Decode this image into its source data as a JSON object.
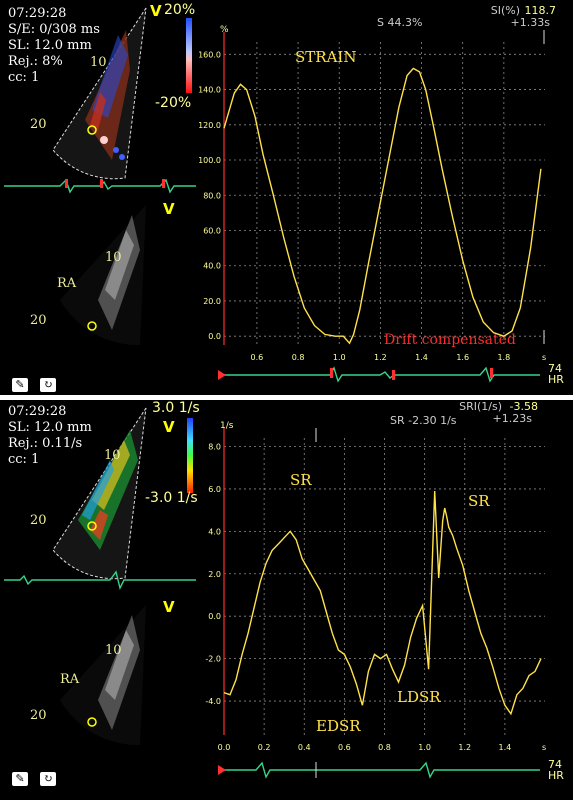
{
  "top": {
    "time": "07:29:28",
    "lines": [
      "S/E: 0/308 ms",
      "SL: 12.0 mm",
      "Rej.: 8%",
      "cc: 1"
    ],
    "scale_top": "20%",
    "scale_bottom": "-20%",
    "v_label": "V",
    "depth_labels": [
      "10",
      "20",
      "10",
      "20"
    ],
    "ra_label": "RA",
    "hr_value": "74",
    "hr_label": "HR"
  },
  "bottom": {
    "time": "07:29:28",
    "lines": [
      "SL: 12.0 mm",
      "Rej.: 0.11/s",
      "cc: 1"
    ],
    "scale_top": "3.0 1/s",
    "scale_bottom": "-3.0 1/s",
    "v_label": "V",
    "depth_labels": [
      "10",
      "20",
      "10",
      "20"
    ],
    "ra_label": "RA",
    "hr_value": "74",
    "hr_label": "HR"
  },
  "colors": {
    "trace": "#ffe24a",
    "axis_text": "#ffff99",
    "grid": "#8a8a8a",
    "ecg": "#35d48a",
    "marker": "#ff3030"
  },
  "chart_data": [
    {
      "type": "line",
      "title": "",
      "ylabel": "%",
      "xlabel": "s",
      "yticks": [
        "0.0",
        "20.0",
        "40.0",
        "60.0",
        "80.0",
        "100.0",
        "120.0",
        "140.0",
        "160.0"
      ],
      "xticks": [
        "0.6",
        "0.8",
        "1.0",
        "1.2",
        "1.4",
        "1.6",
        "1.8",
        "s"
      ],
      "xlim": [
        0.44,
        2.0
      ],
      "ylim": [
        -5,
        167
      ],
      "annotations": {
        "label": "STRAIN",
        "drift": "Drift compensated"
      },
      "readout": {
        "left": "S 44.3%",
        "right_label": "SI(%)",
        "right_value": "118.7",
        "time": "+1.33s"
      },
      "series": [
        {
          "x": [
            0.44,
            0.46,
            0.49,
            0.52,
            0.55,
            0.59,
            0.63,
            0.68,
            0.73,
            0.78,
            0.83,
            0.88,
            0.93,
            0.98,
            1.02,
            1.05,
            1.07,
            1.1,
            1.14,
            1.19,
            1.24,
            1.29,
            1.33,
            1.36,
            1.39,
            1.42,
            1.46,
            1.5,
            1.55,
            1.6,
            1.65,
            1.7,
            1.75,
            1.8,
            1.84,
            1.88,
            1.93,
            1.98
          ],
          "values": [
            118,
            126,
            138,
            143,
            140,
            125,
            103,
            80,
            56,
            34,
            16,
            6,
            1,
            0,
            0,
            -4,
            1,
            15,
            40,
            70,
            100,
            130,
            148,
            152,
            150,
            140,
            118,
            95,
            68,
            43,
            22,
            8,
            2,
            0,
            3,
            16,
            50,
            95
          ]
        }
      ]
    },
    {
      "type": "line",
      "title": "",
      "ylabel": "1/s",
      "xlabel": "s",
      "yticks": [
        "-4.0",
        "-2.0",
        "0.0",
        "2.0",
        "4.0",
        "6.0",
        "8.0"
      ],
      "xticks": [
        "0.0",
        "0.2",
        "0.4",
        "0.6",
        "0.8",
        "1.0",
        "1.2",
        "1.4",
        "s"
      ],
      "xlim": [
        0.0,
        1.6
      ],
      "ylim": [
        -5.6,
        8.4
      ],
      "annotations": {
        "sr1": "SR",
        "sr2": "SR",
        "edsr": "EDSR",
        "ldsr": "LDSR"
      },
      "readout": {
        "left": "SR -2.30 1/s",
        "right_label": "SRI(1/s)",
        "right_value": "-3.58",
        "time": "+1.23s"
      },
      "series": [
        {
          "x": [
            0.0,
            0.03,
            0.06,
            0.09,
            0.12,
            0.15,
            0.18,
            0.21,
            0.24,
            0.27,
            0.3,
            0.33,
            0.36,
            0.39,
            0.42,
            0.45,
            0.48,
            0.51,
            0.54,
            0.57,
            0.6,
            0.63,
            0.66,
            0.69,
            0.72,
            0.75,
            0.78,
            0.81,
            0.84,
            0.87,
            0.9,
            0.93,
            0.96,
            0.99,
            1.02,
            1.05,
            1.07,
            1.09,
            1.1,
            1.11,
            1.12,
            1.14,
            1.16,
            1.19,
            1.22,
            1.25,
            1.28,
            1.31,
            1.34,
            1.37,
            1.4,
            1.43,
            1.46,
            1.49,
            1.52,
            1.55,
            1.58
          ],
          "values": [
            -3.6,
            -3.7,
            -3.0,
            -1.8,
            -0.8,
            0.4,
            1.6,
            2.5,
            3.1,
            3.4,
            3.7,
            4.0,
            3.6,
            2.7,
            2.2,
            1.7,
            1.2,
            0.2,
            -0.8,
            -1.6,
            -1.8,
            -2.4,
            -3.2,
            -4.2,
            -2.6,
            -1.8,
            -2.0,
            -1.8,
            -2.5,
            -3.1,
            -2.3,
            -1.0,
            -0.1,
            0.5,
            -2.5,
            5.9,
            1.8,
            4.5,
            5.1,
            4.7,
            4.2,
            3.8,
            3.2,
            2.4,
            1.2,
            0.2,
            -0.8,
            -1.5,
            -2.4,
            -3.4,
            -4.2,
            -4.6,
            -3.7,
            -3.4,
            -2.8,
            -2.6,
            -2.0
          ]
        }
      ]
    }
  ]
}
